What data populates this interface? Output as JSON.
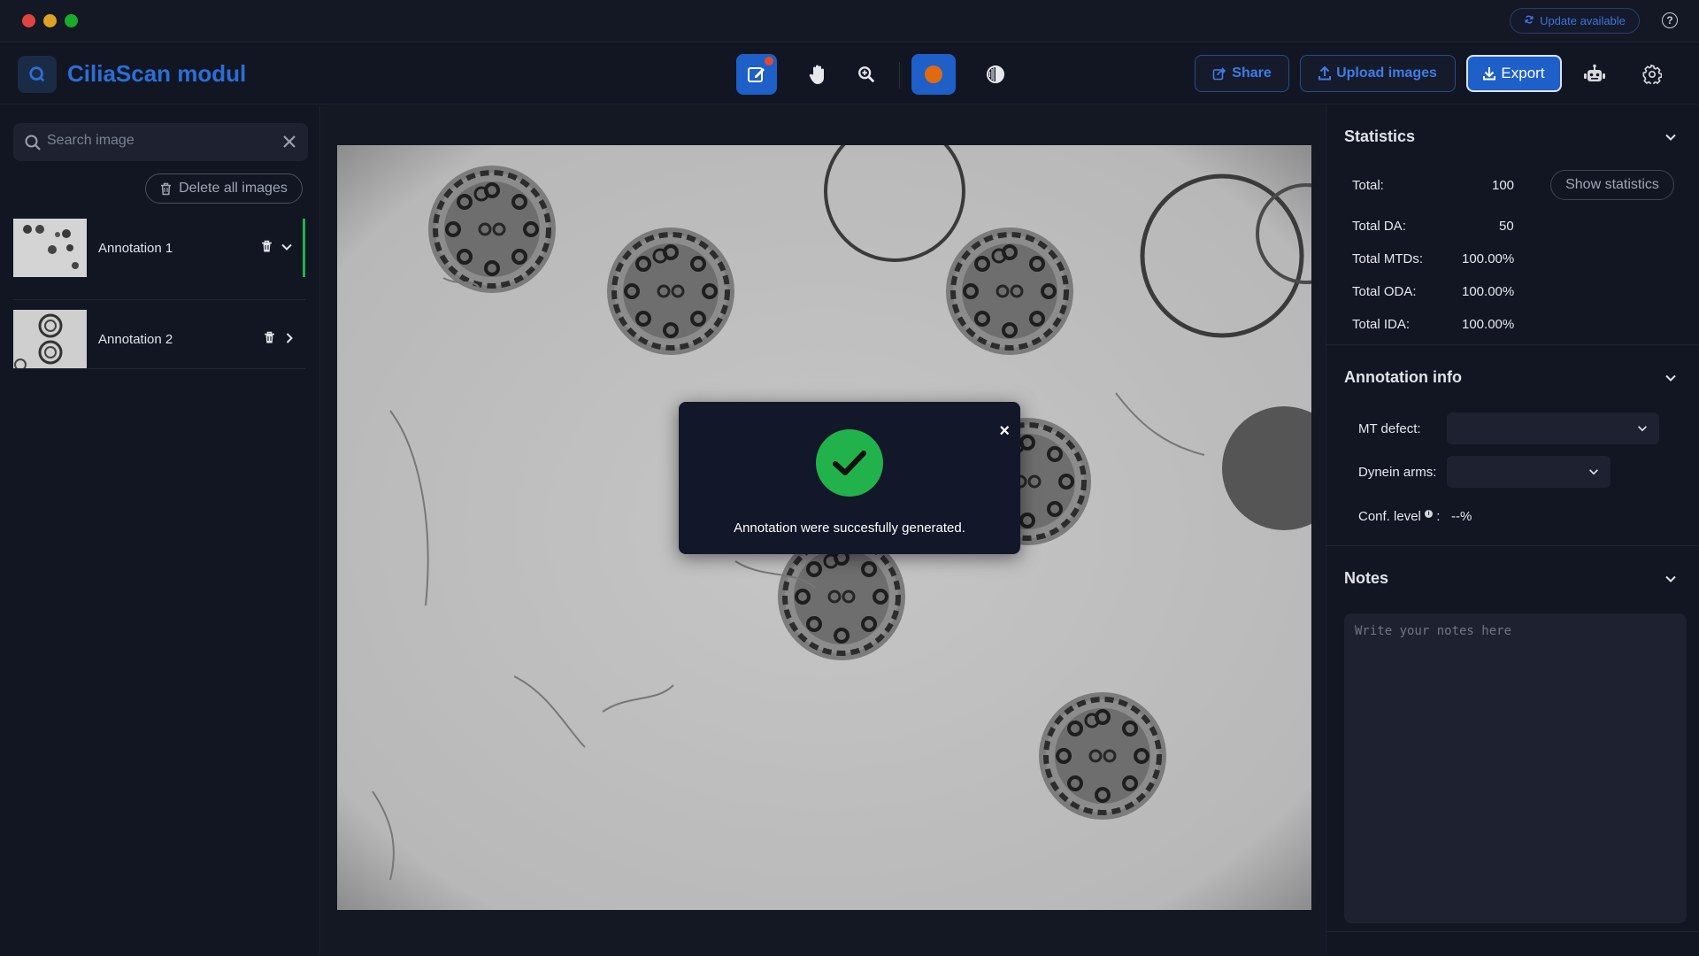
{
  "titlebar": {
    "update_label": "Update available",
    "help_icon": "help-icon"
  },
  "header": {
    "app_title": "CiliaScan modul",
    "tools": [
      "edit-icon",
      "hand-icon",
      "zoom-icon",
      "color-icon",
      "contrast-icon"
    ],
    "share_label": "Share",
    "upload_label": "Upload images",
    "export_label": "Export",
    "accent_color": "#1e5fc8",
    "selected_color": "#e06a12"
  },
  "sidebar": {
    "search_placeholder": "Search image",
    "delete_all_label": "Delete all images",
    "items": [
      {
        "label": "Annotation 1",
        "expanded": true
      },
      {
        "label": "Annotation 2",
        "expanded": false
      }
    ]
  },
  "modal": {
    "message": "Annotation were succesfully generated.",
    "close": "×",
    "success_color": "#22b24c"
  },
  "statistics": {
    "title": "Statistics",
    "show_statistics_label": "Show statistics",
    "rows": [
      {
        "label": "Total:",
        "value": "100"
      },
      {
        "label": "Total DA:",
        "value": "50"
      },
      {
        "label": "Total MTDs:",
        "value": "100.00%"
      },
      {
        "label": "Total ODA:",
        "value": "100.00%"
      },
      {
        "label": "Total IDA:",
        "value": "100.00%"
      }
    ]
  },
  "annotation_info": {
    "title": "Annotation info",
    "mt_defect_label": "MT defect:",
    "mt_defect_value": "",
    "dynein_arms_label": "Dynein arms:",
    "dynein_arms_value": "",
    "conf_level_label": "Conf. level",
    "conf_level_value": "--%"
  },
  "notes": {
    "title": "Notes",
    "placeholder": "Write your notes here"
  }
}
